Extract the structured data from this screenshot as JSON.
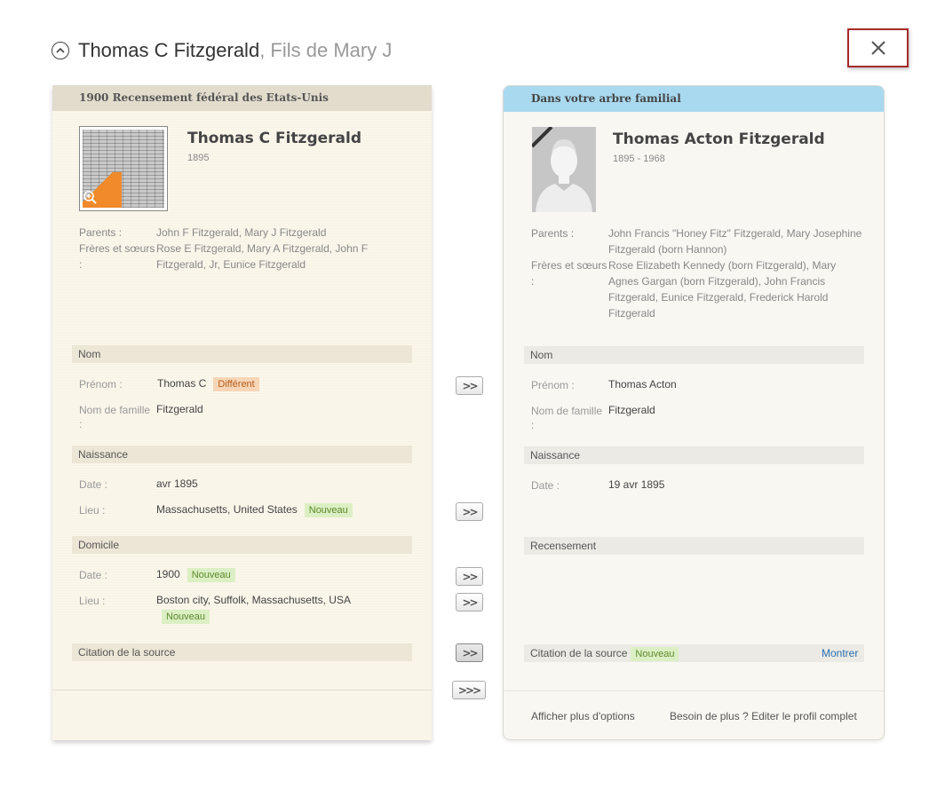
{
  "header": {
    "name": "Thomas C Fitzgerald",
    "relation": ", Fils de Mary J"
  },
  "icons": {
    "collapse": "chevron-up-circle-icon",
    "close": "close-icon",
    "zoom": "zoom-in-icon"
  },
  "left": {
    "title": "1900 Recensement fédéral des Etats-Unis",
    "name": "Thomas C Fitzgerald",
    "dates": "1895",
    "info": [
      {
        "label": "Parents :",
        "value": "John F Fitzgerald, Mary J Fitzgerald"
      },
      {
        "label": "Frères et sœurs :",
        "value": "Rose E Fitzgerald, Mary A Fitzgerald, John F Fitzgerald, Jr, Eunice Fitzgerald"
      }
    ],
    "sections": {
      "nom": "Nom",
      "naissance": "Naissance",
      "domicile": "Domicile",
      "citation": "Citation de la source"
    },
    "fields": {
      "prenom_label": "Prénom :",
      "prenom_value": "Thomas C",
      "prenom_badge": "Différent",
      "famille_label": "Nom de famille :",
      "famille_value": "Fitzgerald",
      "naiss_date_label": "Date :",
      "naiss_date_value": "avr 1895",
      "naiss_lieu_label": "Lieu :",
      "naiss_lieu_value": "Massachusetts, United States",
      "naiss_lieu_badge": "Nouveau",
      "dom_date_label": "Date :",
      "dom_date_value": "1900",
      "dom_date_badge": "Nouveau",
      "dom_lieu_label": "Lieu :",
      "dom_lieu_value": "Boston city, Suffolk, Massachusetts, USA",
      "dom_lieu_badge": "Nouveau"
    }
  },
  "arrows": {
    "single": ">>",
    "all": ">>>"
  },
  "right": {
    "title": "Dans votre arbre familial",
    "name": "Thomas Acton Fitzgerald",
    "dates": "1895 - 1968",
    "info": [
      {
        "label": "Parents :",
        "value": "John Francis \"Honey Fitz\" Fitzgerald, Mary Josephine Fitzgerald (born Hannon)"
      },
      {
        "label": "Frères et sœurs :",
        "value": "Rose Elizabeth Kennedy (born Fitzgerald), Mary Agnes Gargan (born Fitzgerald), John Francis Fitzgerald, Eunice Fitzgerald, Frederick Harold Fitzgerald"
      }
    ],
    "sections": {
      "nom": "Nom",
      "naissance": "Naissance",
      "recensement": "Recensement",
      "citation": "Citation de la source",
      "citation_badge": "Nouveau",
      "show": "Montrer"
    },
    "fields": {
      "prenom_label": "Prénom :",
      "prenom_value": "Thomas Acton",
      "famille_label": "Nom de famille :",
      "famille_value": "Fitzgerald",
      "naiss_date_label": "Date :",
      "naiss_date_value": "19 avr 1895"
    },
    "footer": {
      "more_options": "Afficher plus d'options",
      "edit_profile": "Besoin de plus ? Editer le profil complet"
    }
  }
}
